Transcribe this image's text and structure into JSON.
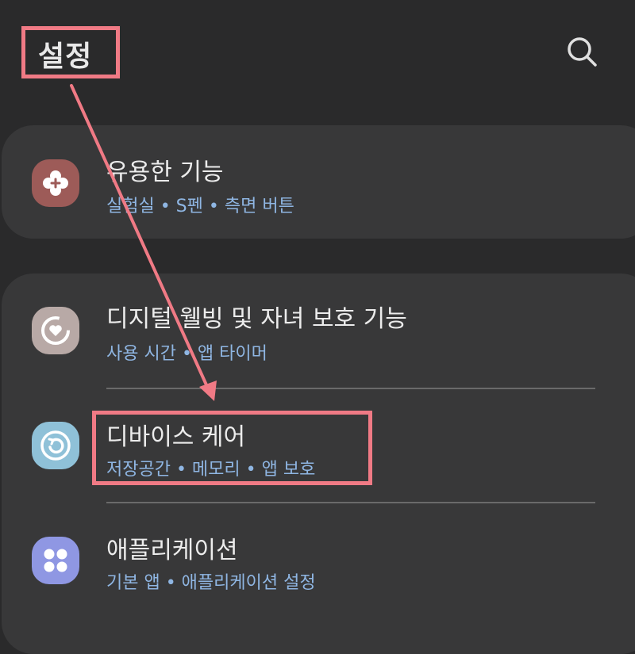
{
  "header": {
    "title": "설정",
    "search_icon": "search-icon"
  },
  "items": [
    {
      "title": "유용한 기능",
      "subtitle": "실험실 • S펜 • 측면 버튼",
      "icon": "plus-flower-icon",
      "color": "#9d5b58"
    },
    {
      "title": "디지털 웰빙 및 자녀 보호 기능",
      "subtitle": "사용 시간 • 앱 타이머",
      "icon": "heart-ring-icon",
      "color": "#b8a9a6"
    },
    {
      "title": "디바이스 케어",
      "subtitle": "저장공간 • 메모리 • 앱 보호",
      "icon": "refresh-care-icon",
      "color": "#8fc1d8"
    },
    {
      "title": "애플리케이션",
      "subtitle": "기본 앱 • 애플리케이션 설정",
      "icon": "apps-grid-icon",
      "color": "#8f97e3"
    }
  ],
  "annotation_color": "#f07a85"
}
